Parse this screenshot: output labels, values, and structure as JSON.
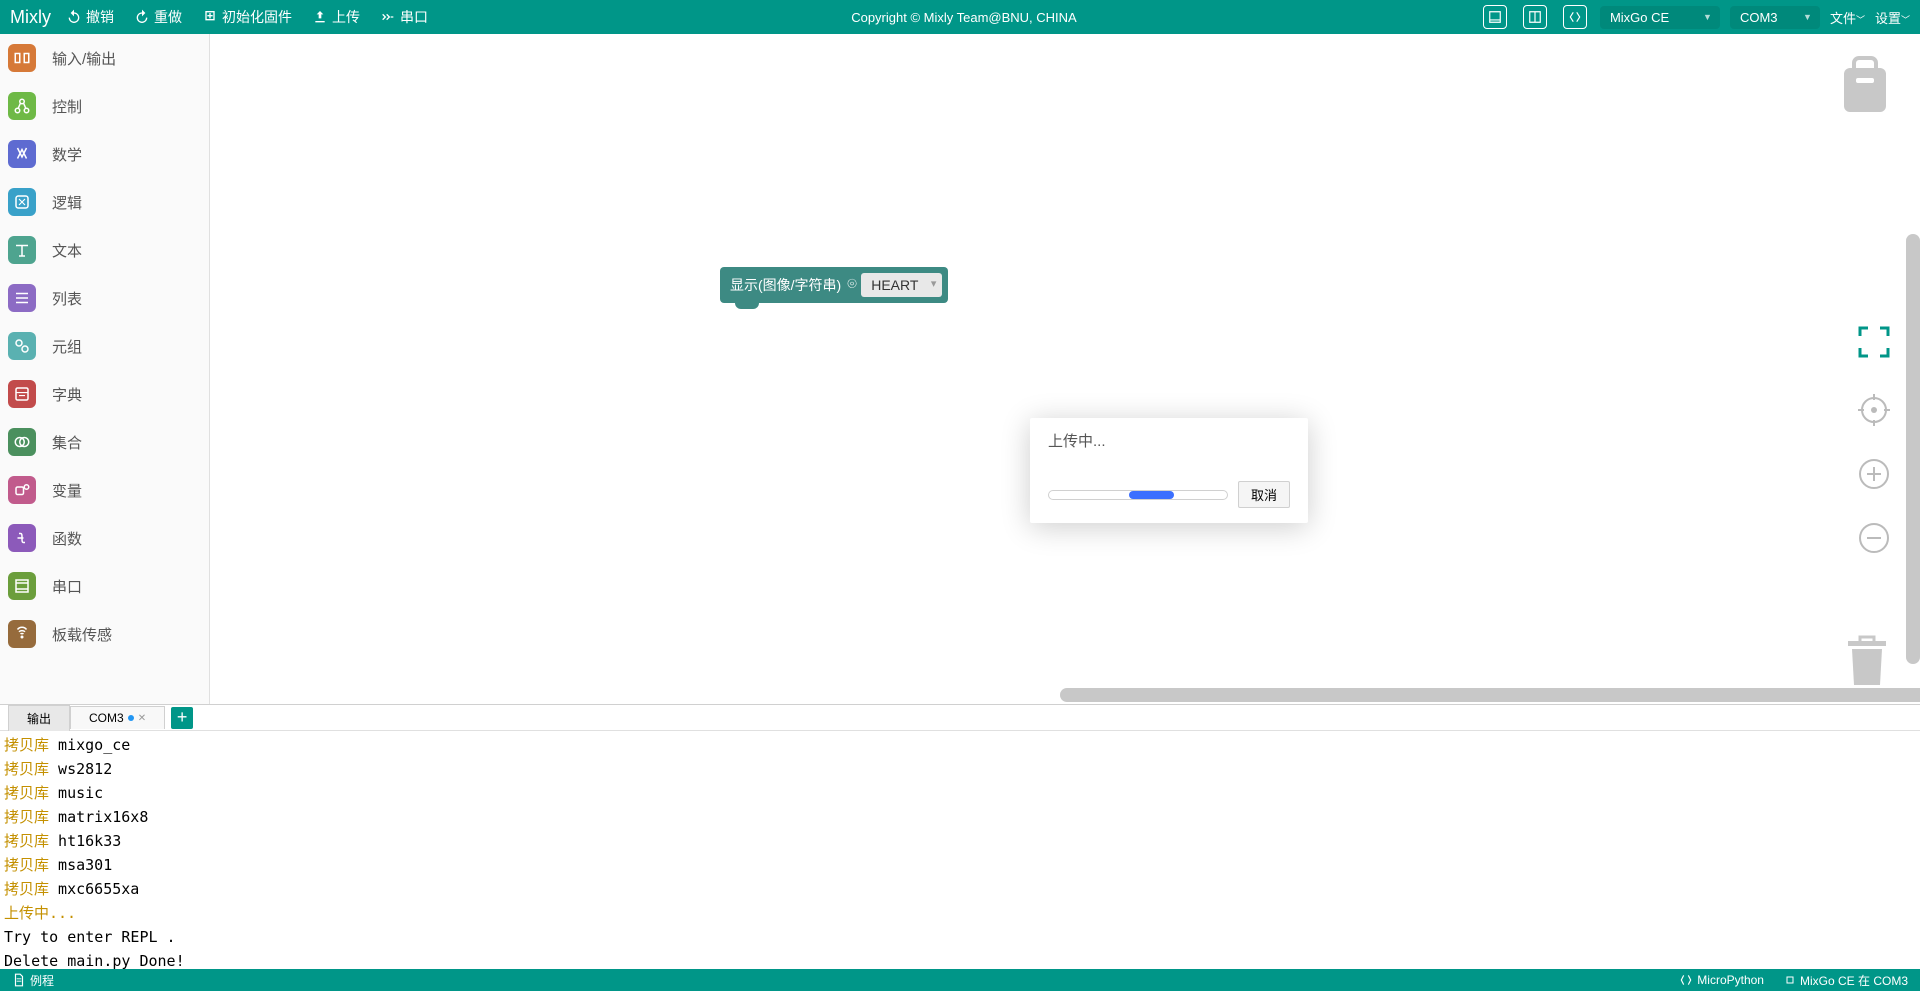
{
  "app": {
    "title": "Mixly",
    "copyright": "Copyright © Mixly Team@BNU, CHINA"
  },
  "toolbar": {
    "undo": "撤销",
    "redo": "重做",
    "init": "初始化固件",
    "upload": "上传",
    "serial": "串口",
    "board": "MixGo CE",
    "port": "COM3",
    "file_menu": "文件",
    "settings_menu": "设置"
  },
  "categories": [
    {
      "label": "输入/输出",
      "color": "#d67938",
      "icon": "io"
    },
    {
      "label": "控制",
      "color": "#6eb946",
      "icon": "ctrl"
    },
    {
      "label": "数学",
      "color": "#5e6bd1",
      "icon": "math"
    },
    {
      "label": "逻辑",
      "color": "#39a1c9",
      "icon": "logic"
    },
    {
      "label": "文本",
      "color": "#4ea48f",
      "icon": "text"
    },
    {
      "label": "列表",
      "color": "#8c6bc4",
      "icon": "list"
    },
    {
      "label": "元组",
      "color": "#5ab1b1",
      "icon": "tuple"
    },
    {
      "label": "字典",
      "color": "#c24b4b",
      "icon": "dict"
    },
    {
      "label": "集合",
      "color": "#4b905e",
      "icon": "set"
    },
    {
      "label": "变量",
      "color": "#c15b8c",
      "icon": "var"
    },
    {
      "label": "函数",
      "color": "#8c5aba",
      "icon": "func"
    },
    {
      "label": "串口",
      "color": "#6b9e3c",
      "icon": "serial"
    },
    {
      "label": "板载传感",
      "color": "#966b3c",
      "icon": "sensor"
    }
  ],
  "block": {
    "label": "显示(图像/字符串)",
    "value": "HEART"
  },
  "modal": {
    "title": "上传中...",
    "cancel": "取消"
  },
  "console": {
    "tabs": [
      {
        "label": "输出"
      },
      {
        "label": "COM3"
      }
    ],
    "lines": [
      {
        "prefix": "拷贝库",
        "text": "mixgo_ce"
      },
      {
        "prefix": "拷贝库",
        "text": "ws2812"
      },
      {
        "prefix": "拷贝库",
        "text": "music"
      },
      {
        "prefix": "拷贝库",
        "text": "matrix16x8"
      },
      {
        "prefix": "拷贝库",
        "text": "ht16k33"
      },
      {
        "prefix": "拷贝库",
        "text": "msa301"
      },
      {
        "prefix": "拷贝库",
        "text": "mxc6655xa"
      },
      {
        "prefix": "上传中...",
        "text": ""
      },
      {
        "prefix": "",
        "text": "Try to enter REPL ."
      },
      {
        "prefix": "",
        "text": "Delete main.py Done!"
      }
    ]
  },
  "status": {
    "example": "例程",
    "lang": "MicroPython",
    "connection": "MixGo CE 在 COM3"
  }
}
